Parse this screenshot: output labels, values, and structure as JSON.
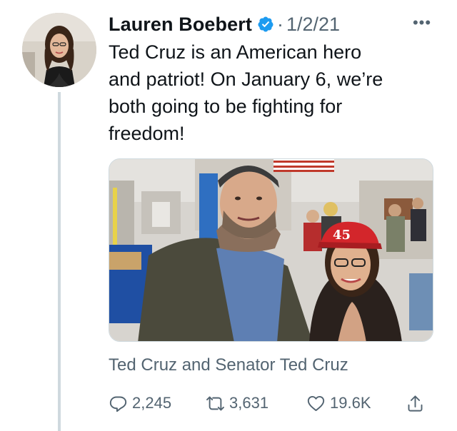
{
  "tweet": {
    "author_name": "Lauren Boebert",
    "separator": "·",
    "date": "1/2/21",
    "more_glyph": "•••",
    "text": "Ted Cruz is an American hero\nand patriot! On January 6, we’re\nboth going to be fighting for\nfreedom!",
    "photo_badge_text": "45",
    "caption": "Ted Cruz and Senator Ted Cruz",
    "stats": {
      "replies": "2,245",
      "retweets": "3,631",
      "likes": "19.6K"
    }
  },
  "icons": {
    "verified": "verified-badge-icon",
    "reply": "reply-bubble-icon",
    "retweet": "retweet-arrows-icon",
    "like": "heart-icon",
    "share": "share-upload-icon",
    "more": "ellipsis-icon"
  },
  "colors": {
    "verified_blue": "#1d9bf0",
    "secondary_text": "#536471",
    "primary_text": "#0f1419",
    "thread_line": "#cfd9de"
  }
}
